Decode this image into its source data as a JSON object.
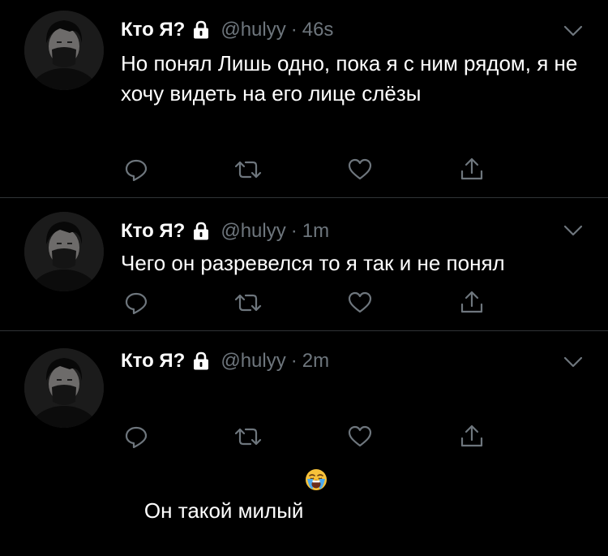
{
  "colors": {
    "background": "#000000",
    "text": "#ffffff",
    "muted": "#6e767d",
    "divider": "#2f3336",
    "lock": "#ffffff"
  },
  "tweets": [
    {
      "name": "Кто Я?",
      "handle": "@hulyy",
      "separator": "·",
      "time": "46s",
      "text": "Но понял Лишь одно, пока я с ним рядом, я не хочу видеть на его лице слёзы",
      "icons": [
        "lock-icon",
        "chevron-down-icon",
        "reply-icon",
        "retweet-icon",
        "like-icon",
        "share-icon"
      ]
    },
    {
      "name": "Кто Я?",
      "handle": "@hulyy",
      "separator": "·",
      "time": "1m",
      "text": "Чего он разревелся то я так и не понял",
      "icons": [
        "lock-icon",
        "chevron-down-icon",
        "reply-icon",
        "retweet-icon",
        "like-icon",
        "share-icon"
      ]
    },
    {
      "name": "Кто Я?",
      "handle": "@hulyy",
      "separator": "·",
      "time": "2m",
      "text": "Он такой милый",
      "emoji": "loudly-crying-face-emoji",
      "icons": [
        "lock-icon",
        "chevron-down-icon",
        "reply-icon",
        "retweet-icon",
        "like-icon",
        "share-icon"
      ]
    }
  ]
}
